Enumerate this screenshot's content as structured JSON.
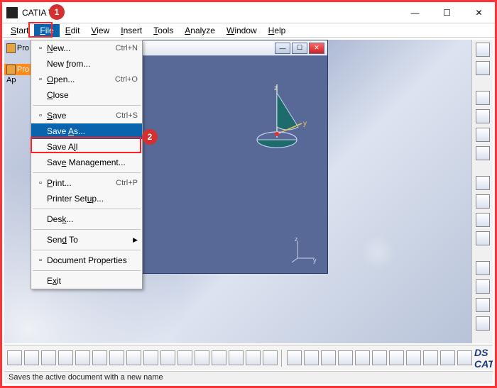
{
  "window": {
    "title": "CATIA V5",
    "min": "—",
    "max": "☐",
    "close": "✕"
  },
  "menubar": {
    "items": [
      {
        "label": "Start",
        "ul": "S"
      },
      {
        "label": "File",
        "ul": "F",
        "active": true
      },
      {
        "label": "Edit",
        "ul": "E"
      },
      {
        "label": "View",
        "ul": "V"
      },
      {
        "label": "Insert",
        "ul": "I"
      },
      {
        "label": "Tools",
        "ul": "T"
      },
      {
        "label": "Analyze",
        "ul": "A"
      },
      {
        "label": "Window",
        "ul": "W"
      },
      {
        "label": "Help",
        "ul": "H"
      }
    ]
  },
  "tree": {
    "root": "Pro",
    "child1": "Pro",
    "child2": "Ap"
  },
  "file_menu": {
    "items": [
      {
        "icon": "new-icon",
        "label": "New...",
        "ul": "N",
        "accel": "Ctrl+N"
      },
      {
        "icon": "",
        "label": "New from...",
        "ul": "f",
        "accel": ""
      },
      {
        "icon": "open-icon",
        "label": "Open...",
        "ul": "O",
        "accel": "Ctrl+O"
      },
      {
        "icon": "",
        "label": "Close",
        "ul": "C",
        "accel": ""
      },
      {
        "sep": true
      },
      {
        "icon": "save-icon",
        "label": "Save",
        "ul": "S",
        "accel": "Ctrl+S"
      },
      {
        "icon": "",
        "label": "Save As...",
        "ul": "A",
        "accel": "",
        "highlight": true
      },
      {
        "icon": "",
        "label": "Save All",
        "ul": "l",
        "accel": ""
      },
      {
        "icon": "",
        "label": "Save Management...",
        "ul": "e",
        "accel": ""
      },
      {
        "sep": true
      },
      {
        "icon": "print-icon",
        "label": "Print...",
        "ul": "P",
        "accel": "Ctrl+P"
      },
      {
        "icon": "",
        "label": "Printer Setup...",
        "ul": "u",
        "accel": ""
      },
      {
        "sep": true
      },
      {
        "icon": "",
        "label": "Desk...",
        "ul": "k",
        "accel": ""
      },
      {
        "sep": true
      },
      {
        "icon": "",
        "label": "Send To",
        "ul": "d",
        "accel": "",
        "sub": true
      },
      {
        "sep": true
      },
      {
        "icon": "docprop-icon",
        "label": "Document Properties",
        "ul": "",
        "accel": ""
      },
      {
        "sep": true
      },
      {
        "icon": "",
        "label": "Exit",
        "ul": "x",
        "accel": ""
      }
    ]
  },
  "docwin": {
    "min": "—",
    "max": "☐",
    "close": "✕",
    "axis_labels": {
      "x": "x",
      "y": "y",
      "z": "z"
    }
  },
  "callouts": {
    "box1_num": "1",
    "box2_num": "2"
  },
  "status": "Saves the active document with a new name",
  "brand": "DS CATIA",
  "right_icons": [
    "workbench-icon",
    "select-icon",
    "pin-icon",
    "gear-icon",
    "cube-icon",
    "disk-icon",
    "rect-icon",
    "grid-icon",
    "layers-icon",
    "axis-icon",
    "mesh-icon",
    "plane-icon",
    "loft-icon",
    "light-icon"
  ],
  "bottom_icons": [
    "new-icon",
    "open-icon",
    "save-icon",
    "saveall-icon",
    "cut-icon",
    "copy-icon",
    "paste-icon",
    "undo-icon",
    "redo-icon",
    "help-icon",
    "fx-icon",
    "axis-icon",
    "table-icon",
    "grid-icon",
    "block-icon",
    "layer-icon",
    "|",
    "compass-icon",
    "fit-icon",
    "pan-icon",
    "rotate-icon",
    "zoom-icon",
    "region-icon",
    "look-icon",
    "flyto-icon",
    "hide-icon",
    "show-icon",
    "collapse-icon"
  ]
}
